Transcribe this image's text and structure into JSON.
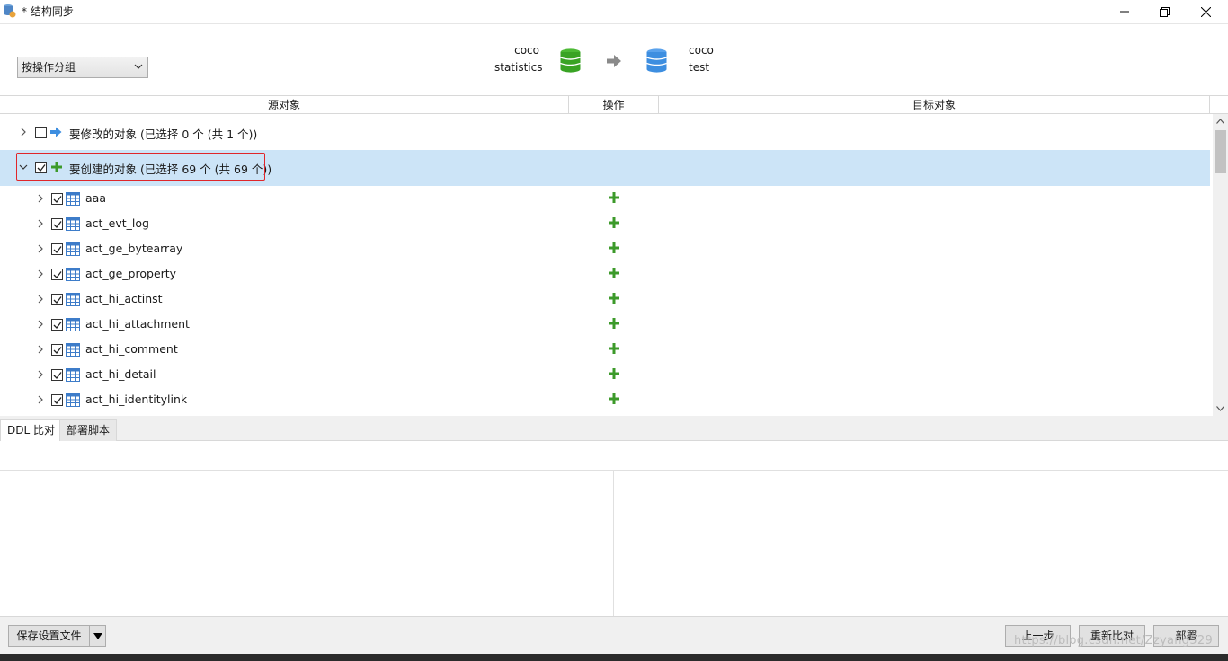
{
  "window": {
    "title": "* 结构同步",
    "icon": "db-sync-icon"
  },
  "header": {
    "group_select": {
      "value": "按操作分组"
    },
    "source": {
      "line1": "coco",
      "line2": "statistics",
      "color": "#39a324"
    },
    "target": {
      "line1": "coco",
      "line2": "test",
      "color": "#3d8ee0"
    }
  },
  "grid": {
    "columns": {
      "source": "源对象",
      "operation": "操作",
      "target": "目标对象"
    }
  },
  "tree": {
    "groups": [
      {
        "label": "要修改的对象 (已选择 0 个 (共 1 个))",
        "checked": false,
        "expanded": false,
        "icon": "arrow-right-icon"
      },
      {
        "label": "要创建的对象 (已选择 69 个 (共 69 个))",
        "checked": true,
        "expanded": true,
        "icon": "plus-icon"
      }
    ],
    "items": [
      {
        "name": "aaa"
      },
      {
        "name": "act_evt_log"
      },
      {
        "name": "act_ge_bytearray"
      },
      {
        "name": "act_ge_property"
      },
      {
        "name": "act_hi_actinst"
      },
      {
        "name": "act_hi_attachment"
      },
      {
        "name": "act_hi_comment"
      },
      {
        "name": "act_hi_detail"
      },
      {
        "name": "act_hi_identitylink"
      }
    ]
  },
  "tabs": {
    "ddl": "DDL 比对",
    "script": "部署脚本"
  },
  "footer": {
    "save_profile": "保存设置文件",
    "prev": "上一步",
    "recompare": "重新比对",
    "deploy": "部署"
  },
  "watermark": "https://blog.csdn.net/Zzyang529",
  "colors": {
    "selected_row": "#cce4f7",
    "plus": "#3c9a2a",
    "highlight": "#e0262a"
  }
}
